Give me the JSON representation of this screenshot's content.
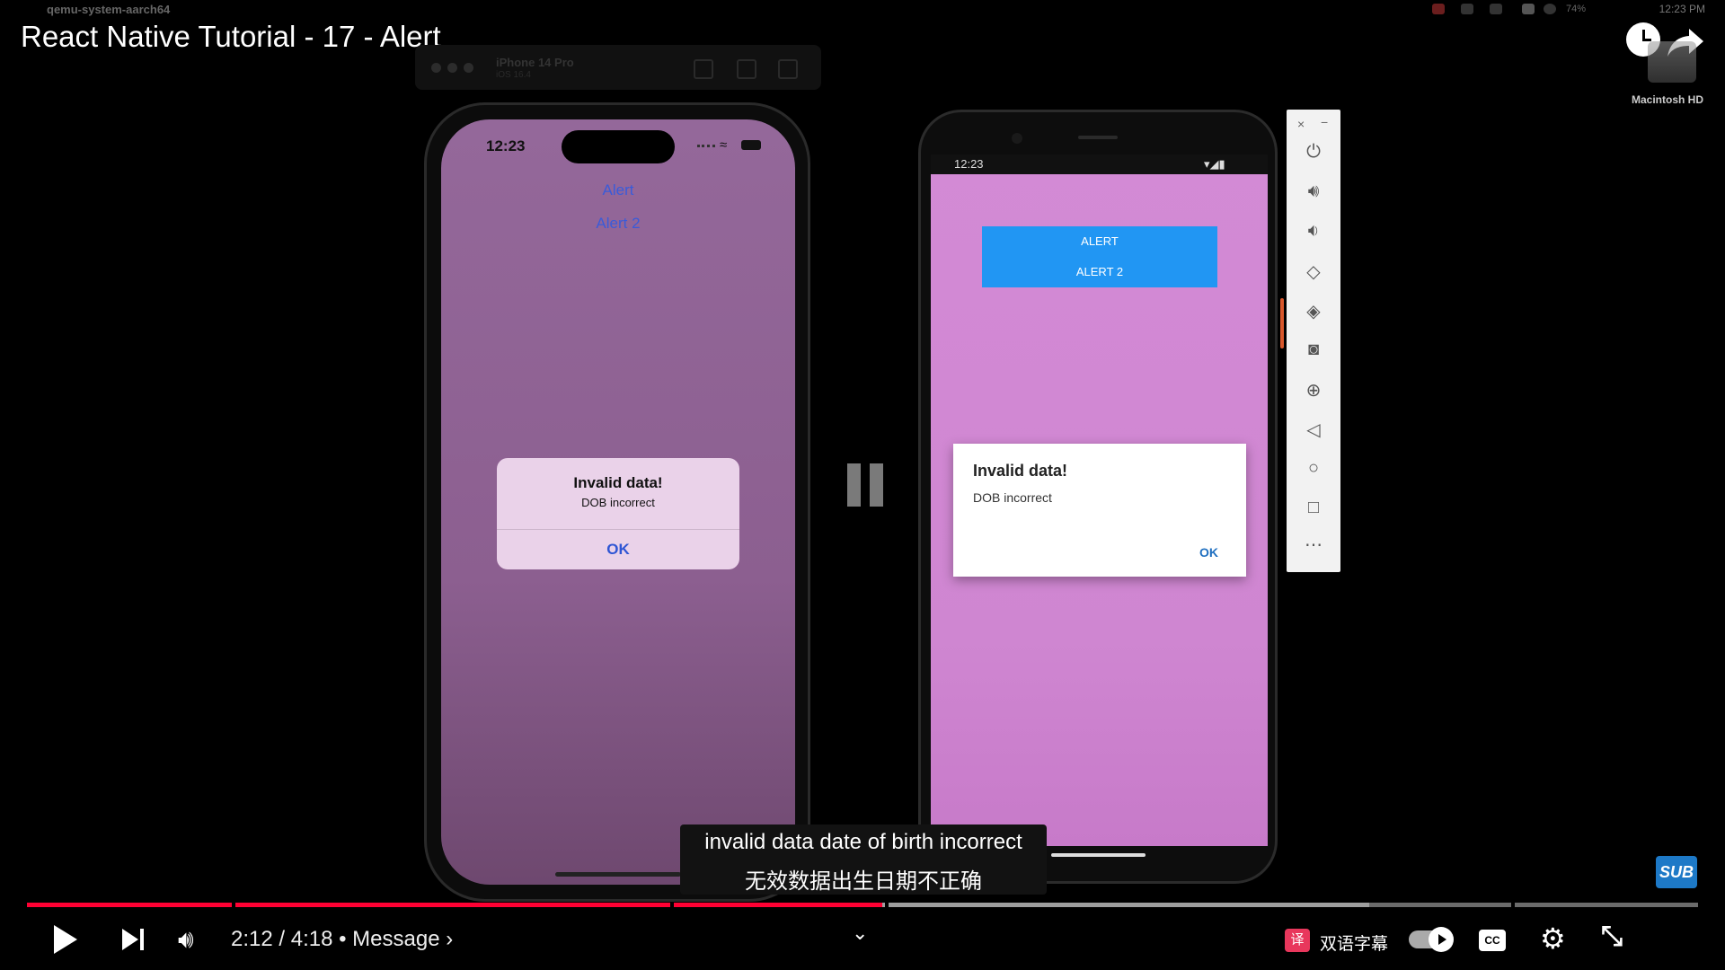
{
  "macos_menubar": {
    "app_name": "qemu-system-aarch64",
    "battery": "74%",
    "clock": "12:23 PM"
  },
  "video": {
    "title": "React Native Tutorial - 17 - Alert",
    "desktop_disk_label": "Macintosh HD"
  },
  "simulator": {
    "device_name": "iPhone 14 Pro",
    "os_version": "iOS 16.4"
  },
  "ios_app": {
    "status_time": "12:23",
    "buttons": [
      "Alert",
      "Alert 2"
    ],
    "alert": {
      "title": "Invalid data!",
      "message": "DOB incorrect",
      "ok": "OK"
    }
  },
  "android_app": {
    "status_time": "12:23",
    "buttons": [
      "ALERT",
      "ALERT 2"
    ],
    "dialog": {
      "title": "Invalid data!",
      "message": "DOB incorrect",
      "ok": "OK"
    }
  },
  "emulator_toolbar": {
    "close": "×",
    "minimize": "−",
    "icons": [
      "power-icon",
      "volume-up-icon",
      "volume-down-icon",
      "rotate-left-icon",
      "rotate-right-icon",
      "camera-icon",
      "zoom-icon",
      "back-icon",
      "home-icon",
      "overview-icon",
      "more-icon"
    ]
  },
  "subtitles": {
    "line_en": "invalid data date of birth incorrect",
    "line_zh": "无效数据出生日期不正确"
  },
  "badge": "SUB",
  "player": {
    "current_time": "2:12",
    "duration": "4:18",
    "time_display": "2:12 / 4:18",
    "chapter": "• Message ›",
    "played_fraction": 0.512,
    "buffered_fraction": 0.803,
    "translate_label": "双语字幕",
    "translate_icon_text": "译",
    "cc_label": "CC",
    "colors": {
      "played": "#ff0033",
      "translate": "#e8375c"
    }
  }
}
